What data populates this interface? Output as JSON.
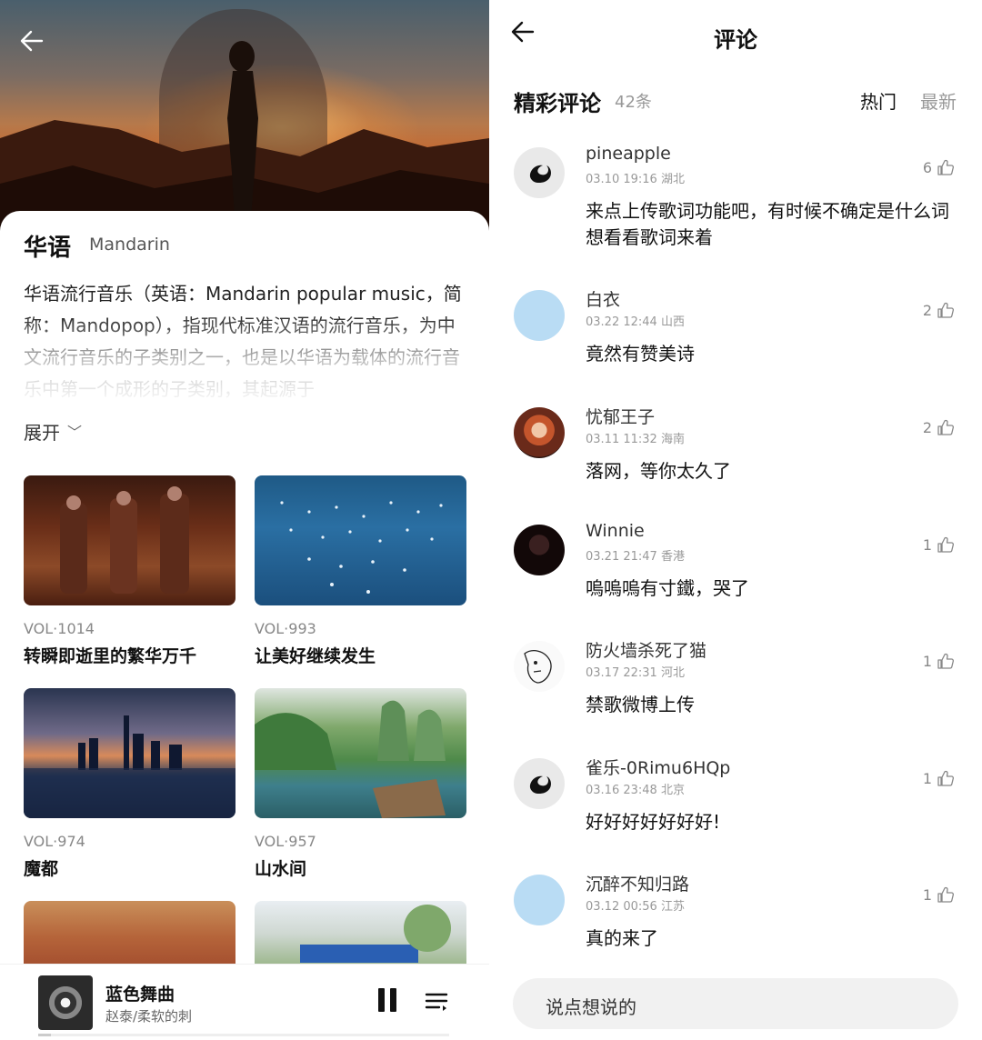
{
  "left": {
    "back_icon": "arrow-left-icon",
    "genre": {
      "title": "华语",
      "subtitle": "Mandarin",
      "description": "华语流行音乐（英语：Mandarin popular music，简称：Mandopop），指现代标准汉语的流行音乐，为中文流行音乐的子类别之一，也是以华语为载体的流行音乐中第一个成形的子类别，其起源于",
      "expand_label": "展开"
    },
    "cards": [
      {
        "vol": "VOL·1014",
        "name": "转瞬即逝里的繁华万千"
      },
      {
        "vol": "VOL·993",
        "name": "让美好继续发生"
      },
      {
        "vol": "VOL·974",
        "name": "魔都"
      },
      {
        "vol": "VOL·957",
        "name": "山水间"
      }
    ],
    "player": {
      "song": "蓝色舞曲",
      "artist": "赵泰/柔软的刺",
      "progress": 0.03
    }
  },
  "right": {
    "title": "评论",
    "section_title": "精彩评论",
    "count": "42条",
    "sort_hot": "热门",
    "sort_new": "最新",
    "comments": [
      {
        "user": "pineapple",
        "meta": "03.10 19:16 湖北",
        "likes": "6",
        "text": "来点上传歌词功能吧，有时候不确定是什么词想看看歌词来着"
      },
      {
        "user": "白衣",
        "meta": "03.22 12:44 山西",
        "likes": "2",
        "text": "竟然有赞美诗"
      },
      {
        "user": "忧郁王子",
        "meta": "03.11 11:32 海南",
        "likes": "2",
        "text": "落网，等你太久了"
      },
      {
        "user": "Winnie",
        "meta": "03.21 21:47 香港",
        "likes": "1",
        "text": "嗚嗚嗚有寸鐵，哭了"
      },
      {
        "user": "防火墙杀死了猫",
        "meta": "03.17 22:31 河北",
        "likes": "1",
        "text": "禁歌微博上传"
      },
      {
        "user": "雀乐-0Rimu6HQp",
        "meta": "03.16 23:48 北京",
        "likes": "1",
        "text": "好好好好好好好!"
      },
      {
        "user": "沉醉不知归路",
        "meta": "03.12 00:56 江苏",
        "likes": "1",
        "text": "真的来了"
      }
    ],
    "input_placeholder": "说点想说的"
  }
}
